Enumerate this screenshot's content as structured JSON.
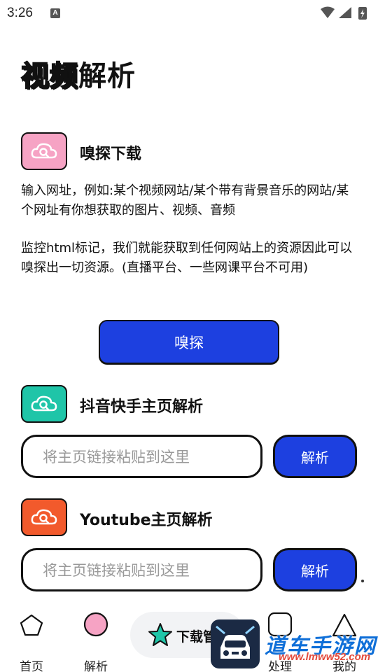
{
  "status_bar": {
    "time": "3:26",
    "notification_icon": "a-icon"
  },
  "title": {
    "outline_part": "视频",
    "solid_part": "解析"
  },
  "sniff_section": {
    "title": "嗅探下载",
    "icon": "cloud-search-icon",
    "icon_color": "#f6a3c4",
    "desc1": "输入网址，例如:某个视频网站/某个带有背景音乐的网站/某个网址有你想获取的图片、视频、音频",
    "desc2": "监控html标记，我们就能获取到任何网站上的资源因此可以嗅探出一切资源。(直播平台、一些网课平台不可用)",
    "button_label": "嗅探"
  },
  "douyin_section": {
    "title": "抖音快手主页解析",
    "icon": "cloud-search-icon",
    "icon_color": "#1fc5a8",
    "input_placeholder": "将主页链接粘贴到这里",
    "button_label": "解析"
  },
  "youtube_section": {
    "title": "Youtube主页解析",
    "icon": "cloud-search-icon",
    "icon_color": "#f25a2c",
    "input_placeholder": "将主页链接粘贴到这里",
    "button_label": "解析"
  },
  "bottom_nav": {
    "home_label": "首页",
    "parse_label": "解析",
    "download_label": "下载管",
    "process_label": "处理",
    "mine_label": "我的"
  },
  "watermark": {
    "text": "道车手游网",
    "url": "www.lmww52.com"
  },
  "colors": {
    "accent_blue": "#1d40e0",
    "parse_pink": "#f6a3c4",
    "star_teal": "#1fc5a8"
  }
}
